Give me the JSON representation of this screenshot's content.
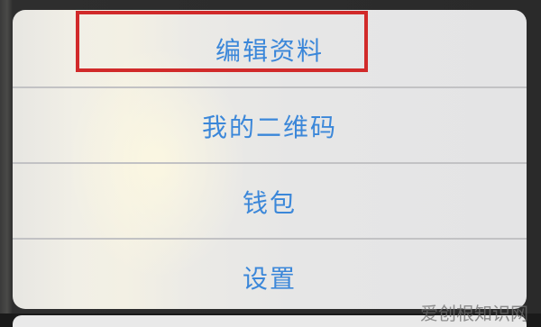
{
  "action_sheet": {
    "items": [
      {
        "label": "编辑资料"
      },
      {
        "label": "我的二维码"
      },
      {
        "label": "钱包"
      },
      {
        "label": "设置"
      }
    ]
  },
  "watermark": "爱创根知识网",
  "colors": {
    "item_text": "#3b87d9",
    "highlight_border": "#d12a2a",
    "sheet_bg": "#e6e6e6",
    "divider": "#c2c2c4"
  }
}
